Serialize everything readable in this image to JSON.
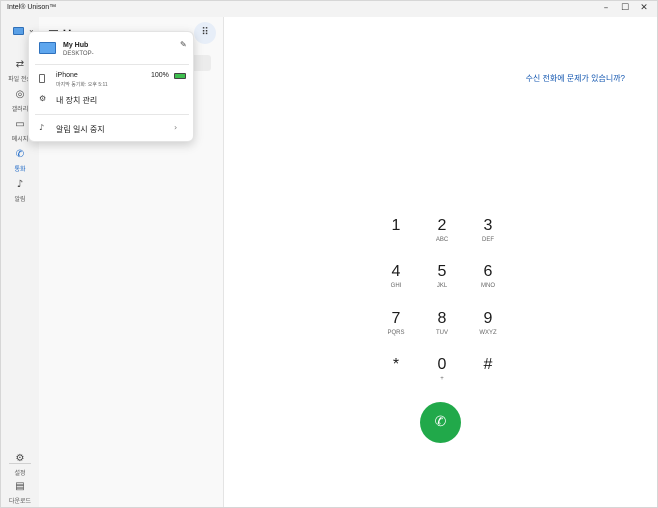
{
  "window": {
    "title": "Intel® Unison™",
    "minimize_icon": "minimize-icon",
    "maximize_icon": "maximize-icon",
    "close_icon": "close-icon"
  },
  "rail": {
    "items": [
      {
        "label": "파일 전송",
        "icon": "transfer-icon",
        "active": false
      },
      {
        "label": "갤러리",
        "icon": "gallery-icon",
        "active": false
      },
      {
        "label": "메시지",
        "icon": "message-icon",
        "active": false
      },
      {
        "label": "통화",
        "icon": "phone-icon",
        "active": true
      },
      {
        "label": "알림",
        "icon": "bell-icon",
        "active": false
      }
    ],
    "bottom_items": [
      {
        "label": "설정",
        "icon": "gear-icon"
      },
      {
        "label": "다운로드",
        "icon": "folder-icon"
      }
    ]
  },
  "middle": {
    "title": "통화"
  },
  "right": {
    "problem_link": "수신 전화에 문제가 있습니까?",
    "dialpad": [
      {
        "digit": "1",
        "letters": ""
      },
      {
        "digit": "2",
        "letters": "ABC"
      },
      {
        "digit": "3",
        "letters": "DEF"
      },
      {
        "digit": "4",
        "letters": "GHI"
      },
      {
        "digit": "5",
        "letters": "JKL"
      },
      {
        "digit": "6",
        "letters": "MNO"
      },
      {
        "digit": "7",
        "letters": "PQRS"
      },
      {
        "digit": "8",
        "letters": "TUV"
      },
      {
        "digit": "9",
        "letters": "WXYZ"
      },
      {
        "digit": "*",
        "letters": ""
      },
      {
        "digit": "0",
        "letters": "+"
      },
      {
        "digit": "#",
        "letters": ""
      }
    ]
  },
  "flyout": {
    "hub_name": "My Hub",
    "hub_host": "DESKTOP-",
    "phone_name": "iPhone",
    "phone_sync": "마지막 동기화: 오후 5:11",
    "battery": "100%",
    "manage_devices": "내 장치 관리",
    "pause_notifications": "알림 일시 중지"
  },
  "colors": {
    "accent": "#1261c4",
    "call_green": "#21a94a",
    "link": "#1256b0"
  }
}
